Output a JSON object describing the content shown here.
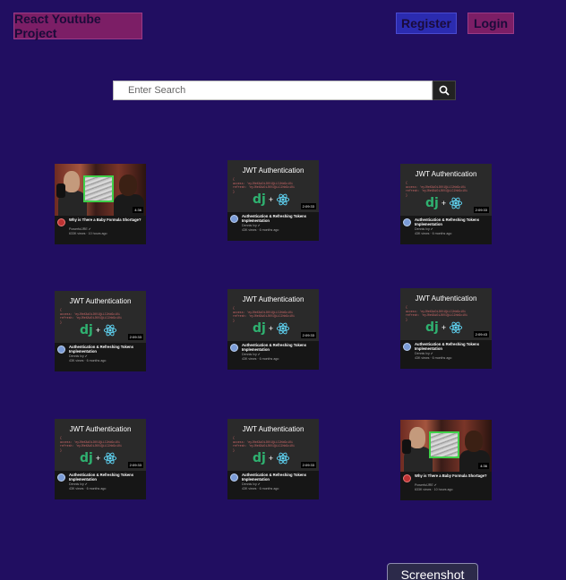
{
  "header": {
    "brand": "React Youtube Project",
    "register_label": "Register",
    "login_label": "Login"
  },
  "search": {
    "placeholder": "Enter Search",
    "value": ""
  },
  "videos": [
    {
      "kind": "rogan",
      "title": "Why is There a Baby Formula Shortage?",
      "channel": "PowerfulJRE",
      "stats": "633K views · 10 hours ago",
      "duration": "4:36"
    },
    {
      "kind": "jwt",
      "thumb_title": "JWT Authentication",
      "title": "Authentication & Refreshing Tokens Implementation",
      "channel": "Dennis Ivy",
      "stats": "43K views · 6 months ago",
      "duration": "2:09:33"
    },
    {
      "kind": "jwt",
      "thumb_title": "JWT Authentication",
      "title": "Authentication & Refreshing Tokens Implementation",
      "channel": "Dennis Ivy",
      "stats": "43K views · 6 months ago",
      "duration": "2:09:33"
    },
    {
      "kind": "jwt",
      "thumb_title": "JWT Authentication",
      "title": "Authentication & Refreshing Tokens Implementation",
      "channel": "Dennis Ivy",
      "stats": "43K views · 6 months ago",
      "duration": "2:09:33"
    },
    {
      "kind": "jwt",
      "thumb_title": "JWT Authentication",
      "title": "Authentication & Refreshing Tokens Implementation",
      "channel": "Dennis Ivy",
      "stats": "43K views · 6 months ago",
      "duration": "2:09:33"
    },
    {
      "kind": "jwt",
      "thumb_title": "JWT Authentication",
      "title": "Authentication & Refreshing Tokens Implementation",
      "channel": "Dennis Ivy",
      "stats": "43K views · 6 months ago",
      "duration": "2:09:43"
    },
    {
      "kind": "jwt",
      "thumb_title": "JWT Authentication",
      "title": "Authentication & Refreshing Tokens Implementation",
      "channel": "Dennis Ivy",
      "stats": "43K views · 6 months ago",
      "duration": "2:09:33"
    },
    {
      "kind": "jwt",
      "thumb_title": "JWT Authentication",
      "title": "Authentication & Refreshing Tokens Implementation",
      "channel": "Dennis Ivy",
      "stats": "43K views · 6 months ago",
      "duration": "2:09:33"
    },
    {
      "kind": "rogan",
      "title": "Why is There a Baby Formula Shortage?",
      "channel": "PowerfulJRE",
      "stats": "633K views · 10 hours ago",
      "duration": "4:36"
    }
  ],
  "code_lines": {
    "access": "access: 'eyJ0eXAiOiJKV1QiLCJhbGciOi",
    "refresh": "refresh: 'eyJ0eXAiOiJKV1QiLCJhbGciOi"
  },
  "footer": {
    "screenshot_label": "Screenshot"
  },
  "colors": {
    "background": "#210e61",
    "brand_bg": "#7c1e66",
    "register_bg": "#2b2bb0",
    "login_bg": "#7c1e66",
    "django_green": "#2fb170",
    "react_blue": "#61dafb"
  },
  "icons": {
    "search": "search-icon",
    "react": "react-logo-icon",
    "verified": "verified-check-icon"
  }
}
